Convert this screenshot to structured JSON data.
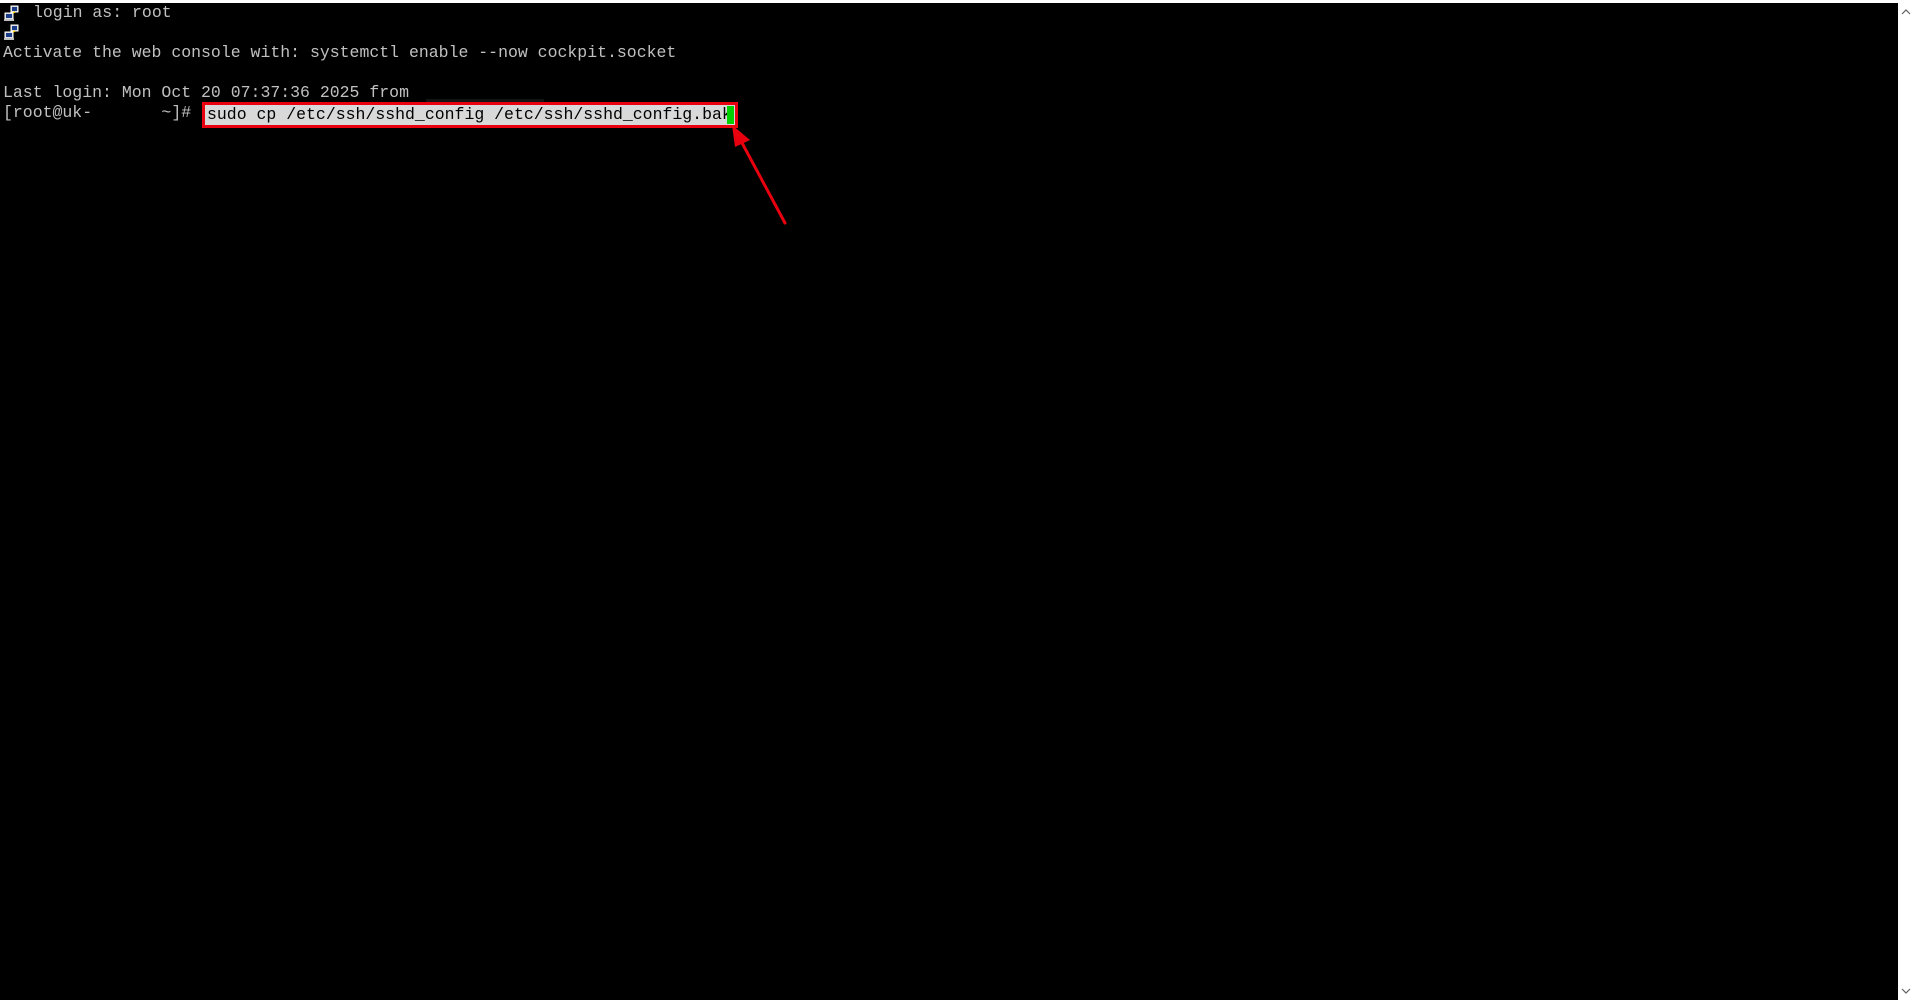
{
  "terminal": {
    "line1": "login as: root",
    "line2": "Activate the web console with: systemctl enable --now cockpit.socket",
    "line3": "Last login: Mon Oct 20 07:37:36 2025 from",
    "prompt": "[root@uk-       ~]#",
    "command": "sudo cp /etc/ssh/sshd_config /etc/ssh/sshd_config.bak",
    "icons": [
      "computer-key-icon",
      "computer-key-icon"
    ]
  },
  "annotation": {
    "highlight_color": "#e8000f",
    "cursor_color": "#00d000",
    "arrow_color": "#e8000f"
  },
  "colors": {
    "background": "#000000",
    "foreground": "#c0c0c0"
  }
}
